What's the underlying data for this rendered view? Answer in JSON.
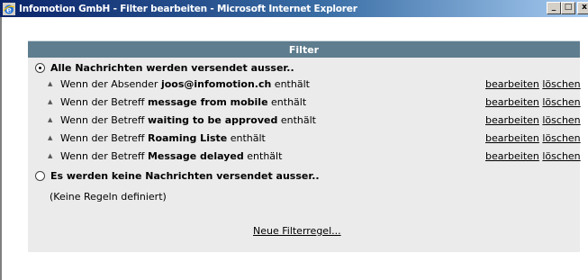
{
  "window": {
    "title": "Infomotion GmbH - Filter bearbeiten - Microsoft Internet Explorer",
    "minimize": "_",
    "maximize": "□",
    "close": "x"
  },
  "panel": {
    "header": "Filter",
    "option_all": "Alle Nachrichten werden versendet ausser..",
    "option_none": "Es werden keine Nachrichten versendet ausser..",
    "no_rules": "(Keine Regeln definiert)",
    "new_rule": "Neue Filterregel..."
  },
  "rules": [
    {
      "prefix": "Wenn der Absender ",
      "value": "joos@infomotion.ch",
      "suffix": " enthält",
      "edit": "bearbeiten",
      "delete": "löschen"
    },
    {
      "prefix": "Wenn der Betreff ",
      "value": "message from mobile",
      "suffix": " enthält",
      "edit": "bearbeiten",
      "delete": "löschen"
    },
    {
      "prefix": "Wenn der Betreff ",
      "value": "waiting to be approved",
      "suffix": " enthält",
      "edit": "bearbeiten",
      "delete": "löschen"
    },
    {
      "prefix": "Wenn der Betreff ",
      "value": "Roaming Liste",
      "suffix": " enthält",
      "edit": "bearbeiten",
      "delete": "löschen"
    },
    {
      "prefix": "Wenn der Betreff ",
      "value": "Message delayed",
      "suffix": " enthält",
      "edit": "bearbeiten",
      "delete": "löschen"
    }
  ],
  "colors": {
    "header_bg": "#5e7d8e",
    "body_bg": "#ebebeb",
    "titlebar_start": "#0a246a",
    "titlebar_end": "#a6caf0"
  },
  "icons": {
    "window": "internet-explorer-icon",
    "rule_bullet": "triangle-up-icon"
  }
}
